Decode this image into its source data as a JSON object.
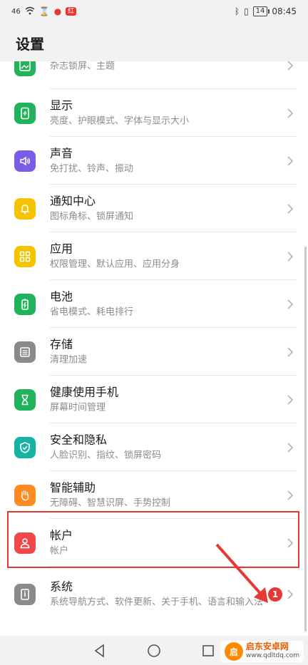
{
  "status_bar": {
    "signal": "46",
    "badge": "红",
    "battery": "14",
    "time": "08:45"
  },
  "header": {
    "title": "设置"
  },
  "items": [
    {
      "title": "",
      "sub": "杂志锁屏、主题",
      "icon": "wallpaper-icon",
      "color": "#23b35a"
    },
    {
      "title": "显示",
      "sub": "亮度、护眼模式、字体与显示大小",
      "icon": "display-icon",
      "color": "#21b35b"
    },
    {
      "title": "声音",
      "sub": "免打扰、铃声、振动",
      "icon": "sound-icon",
      "color": "#7a5ce6"
    },
    {
      "title": "通知中心",
      "sub": "图标角标、锁屏通知",
      "icon": "bell-icon",
      "color": "#f5c400"
    },
    {
      "title": "应用",
      "sub": "权限管理、默认应用、应用分身",
      "icon": "apps-icon",
      "color": "#f5c400"
    },
    {
      "title": "电池",
      "sub": "省电模式、耗电排行",
      "icon": "battery-icon",
      "color": "#21b35b"
    },
    {
      "title": "存储",
      "sub": "清理加速",
      "icon": "storage-icon",
      "color": "#8a8a8a"
    },
    {
      "title": "健康使用手机",
      "sub": "屏幕时间管理",
      "icon": "hourglass-icon",
      "color": "#21b35b"
    },
    {
      "title": "安全和隐私",
      "sub": "人脸识别、指纹、锁屏密码",
      "icon": "shield-icon",
      "color": "#16b3a4"
    },
    {
      "title": "智能辅助",
      "sub": "无障碍、智慧识屏、手势控制",
      "icon": "hand-icon",
      "color": "#ff8a1f"
    },
    {
      "title": "帐户",
      "sub": "帐户",
      "icon": "user-icon",
      "color": "#f0474a"
    },
    {
      "title": "系统",
      "sub": "系统导航方式、软件更新、关于手机、语言和输入法",
      "icon": "system-icon",
      "color": "#8a8a8a",
      "notification_count": "1"
    }
  ],
  "watermark": {
    "logo": "启",
    "name": "启东安卓网",
    "url": "www.qdltdq.com"
  }
}
